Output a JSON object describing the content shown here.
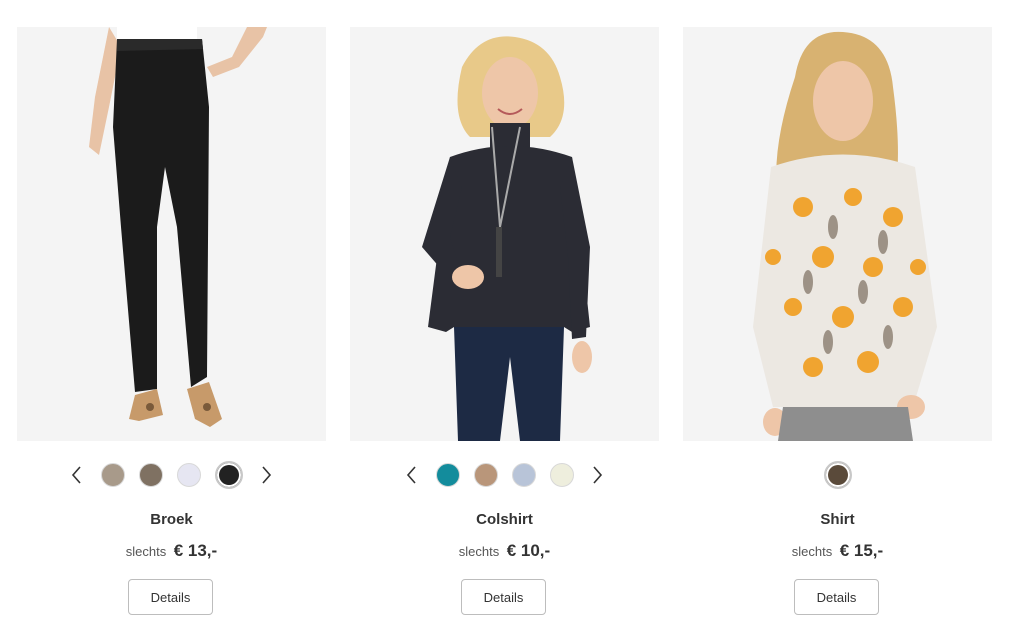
{
  "products": [
    {
      "name": "Broek",
      "price_prefix": "slechts",
      "price": "€ 13,-",
      "details_label": "Details",
      "image_icon": "trousers-photo",
      "swatches": [
        "#a89a8a",
        "#7f7162",
        "#e6e6f2",
        "#222222"
      ],
      "selected_swatch": 3,
      "has_arrows": true
    },
    {
      "name": "Colshirt",
      "price_prefix": "slechts",
      "price": "€ 10,-",
      "details_label": "Details",
      "image_icon": "turtleneck-photo",
      "swatches": [
        "#138c9c",
        "#b9967a",
        "#b8c4d8",
        "#eeeedd"
      ],
      "selected_swatch": null,
      "has_arrows": true
    },
    {
      "name": "Shirt",
      "price_prefix": "slechts",
      "price": "€ 15,-",
      "details_label": "Details",
      "image_icon": "floral-shirt-photo",
      "swatches": [
        "#5a4a3a"
      ],
      "selected_swatch": 0,
      "has_arrows": false
    }
  ]
}
